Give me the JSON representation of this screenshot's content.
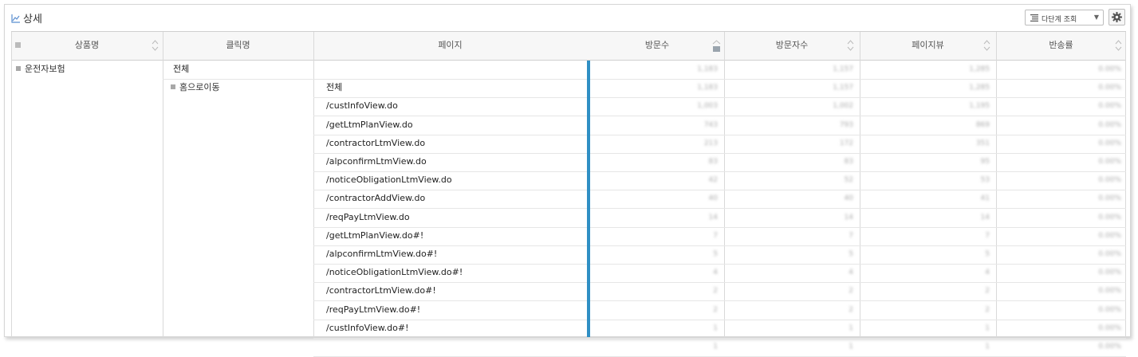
{
  "panel": {
    "title": "상세",
    "view_mode": "다단계 조회",
    "settings_icon": "gear-icon"
  },
  "columns": {
    "product": "상품명",
    "click": "클릭명",
    "page": "페이지",
    "visits": "방문수",
    "visitors": "방문자수",
    "pageviews": "페이지뷰",
    "bounce": "반송률"
  },
  "group": {
    "product": "운전자보험",
    "total_label": "전체",
    "click_group": "홈으로이동"
  },
  "rows": [
    {
      "page": "전체",
      "v": "1,183",
      "u": "1,157",
      "pv": "1,285",
      "b": "0.00%"
    },
    {
      "page": "/custInfoView.do",
      "v": "1,003",
      "u": "1,002",
      "pv": "1,195",
      "b": "0.00%"
    },
    {
      "page": "/getLtmPlanView.do",
      "v": "743",
      "u": "793",
      "pv": "869",
      "b": "0.00%"
    },
    {
      "page": "/contractorLtmView.do",
      "v": "213",
      "u": "172",
      "pv": "351",
      "b": "0.00%"
    },
    {
      "page": "/alpconfirmLtmView.do",
      "v": "83",
      "u": "83",
      "pv": "95",
      "b": "0.00%"
    },
    {
      "page": "/noticeObligationLtmView.do",
      "v": "42",
      "u": "52",
      "pv": "53",
      "b": "0.00%"
    },
    {
      "page": "/contractorAddView.do",
      "v": "40",
      "u": "40",
      "pv": "41",
      "b": "0.00%"
    },
    {
      "page": "/reqPayLtmView.do",
      "v": "14",
      "u": "14",
      "pv": "14",
      "b": "0.00%"
    },
    {
      "page": "/getLtmPlanView.do#!",
      "v": "7",
      "u": "7",
      "pv": "7",
      "b": "0.00%"
    },
    {
      "page": "/alpconfirmLtmView.do#!",
      "v": "5",
      "u": "5",
      "pv": "5",
      "b": "0.00%"
    },
    {
      "page": "/noticeObligationLtmView.do#!",
      "v": "4",
      "u": "4",
      "pv": "4",
      "b": "0.00%"
    },
    {
      "page": "/contractorLtmView.do#!",
      "v": "2",
      "u": "2",
      "pv": "2",
      "b": "0.00%"
    },
    {
      "page": "/reqPayLtmView.do#!",
      "v": "2",
      "u": "2",
      "pv": "2",
      "b": "0.00%"
    },
    {
      "page": "/custInfoView.do#!",
      "v": "1",
      "u": "1",
      "pv": "1",
      "b": "0.00%"
    },
    {
      "page": "",
      "v": "1",
      "u": "1",
      "pv": "1",
      "b": "0.00%"
    }
  ]
}
